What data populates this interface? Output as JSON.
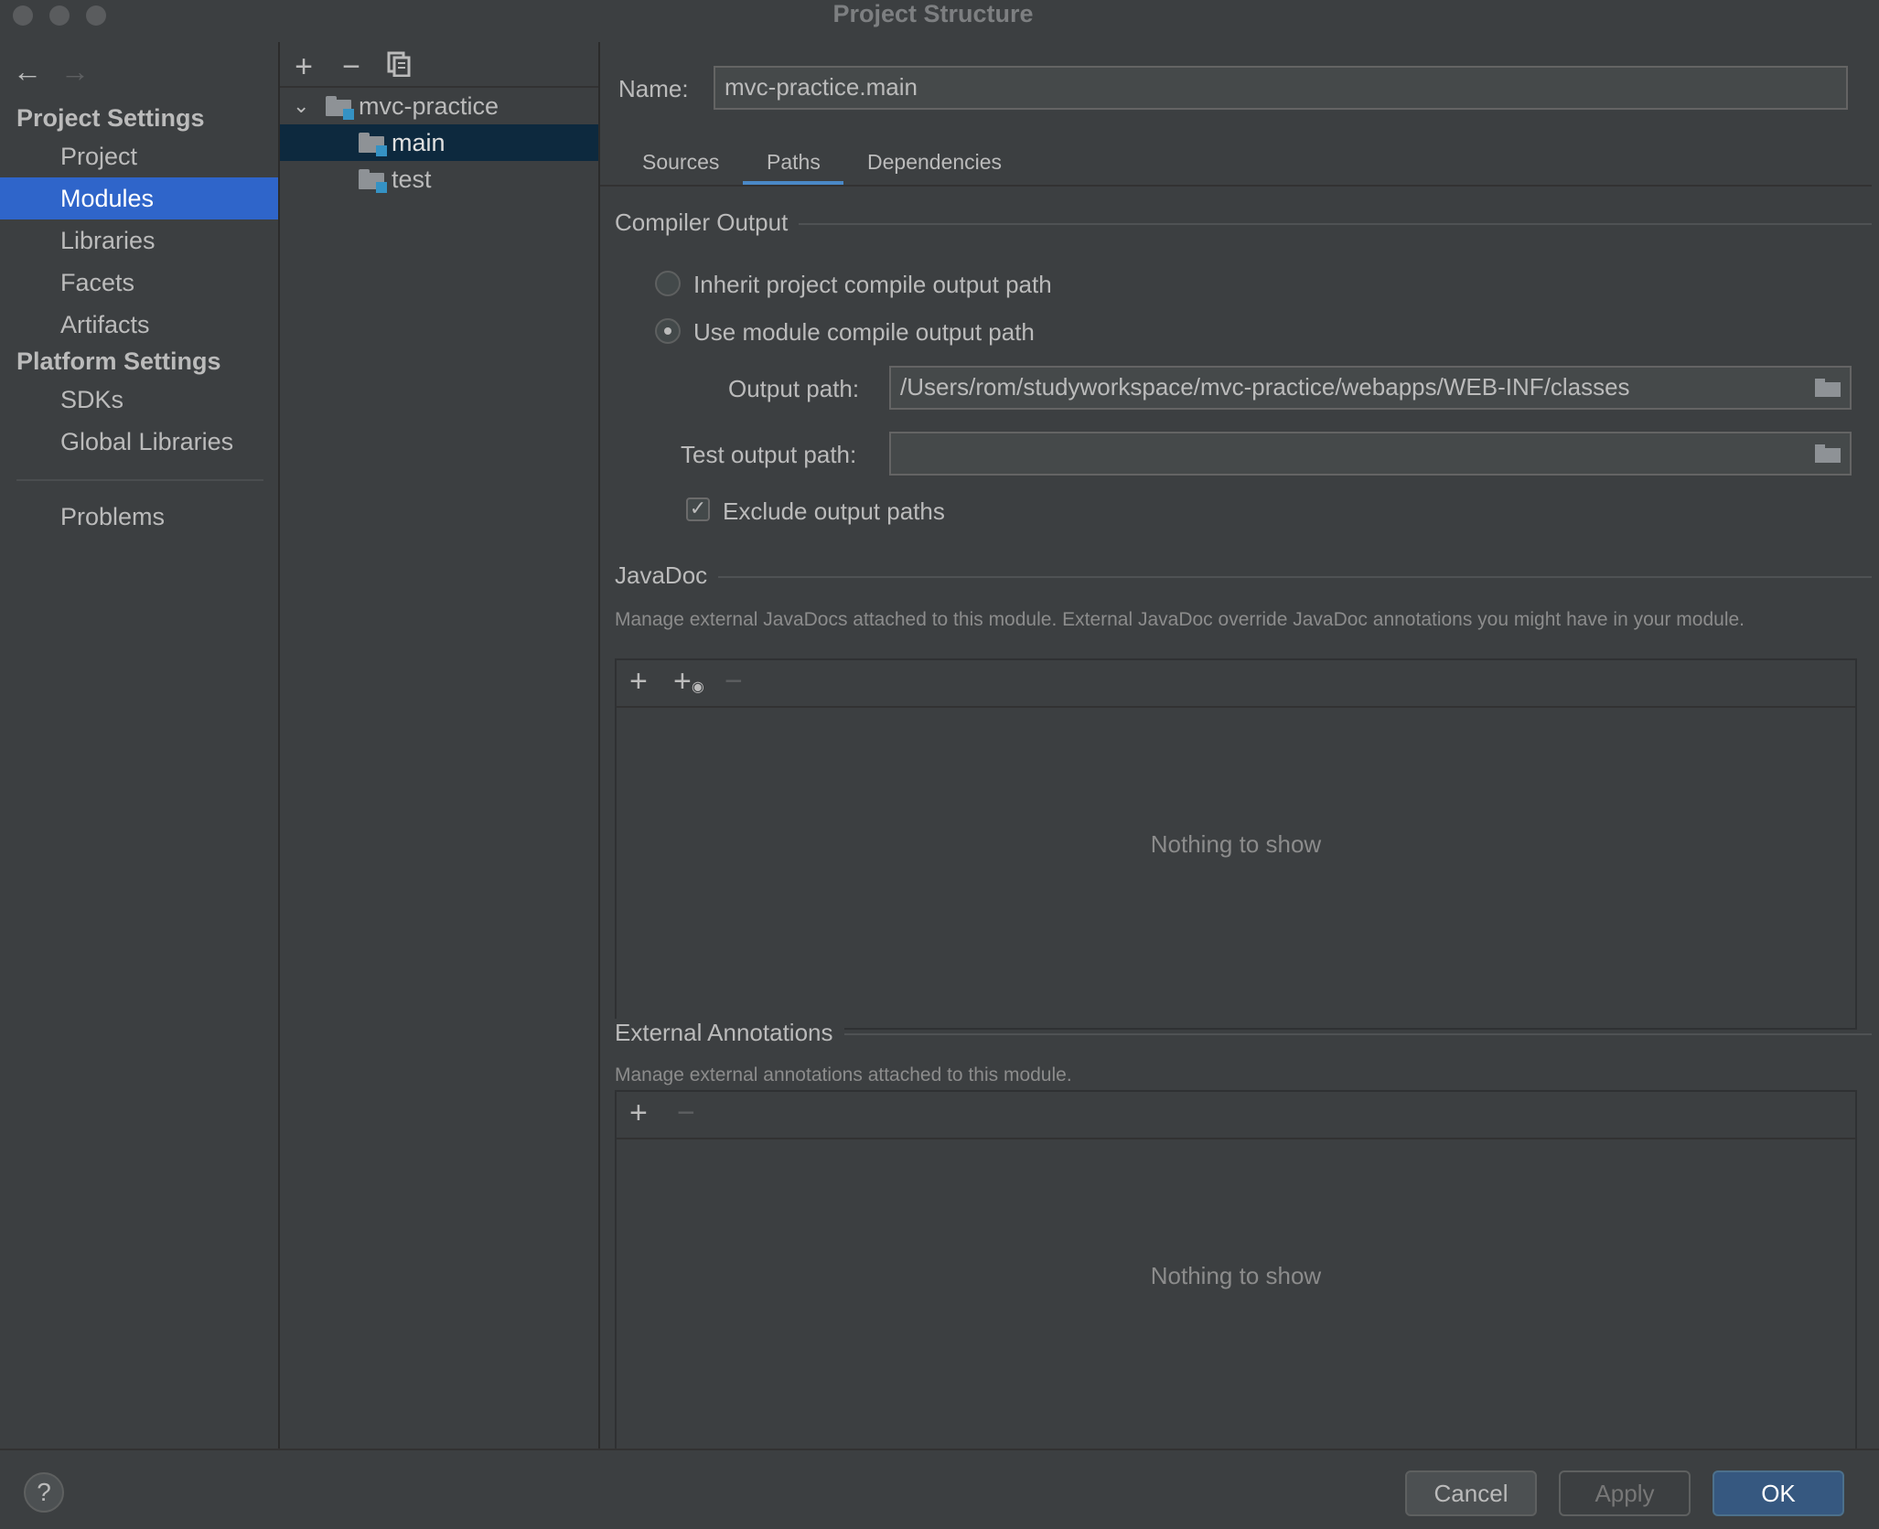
{
  "window": {
    "title": "Project Structure"
  },
  "nav": {
    "back_icon": "back-arrow-icon",
    "forward_icon": "forward-arrow-icon",
    "project_settings_header": "Project Settings",
    "platform_settings_header": "Platform Settings",
    "items": [
      {
        "label": "Project"
      },
      {
        "label": "Modules",
        "selected": true
      },
      {
        "label": "Libraries"
      },
      {
        "label": "Facets"
      },
      {
        "label": "Artifacts"
      }
    ],
    "platform_items": [
      {
        "label": "SDKs"
      },
      {
        "label": "Global Libraries"
      }
    ],
    "problems_label": "Problems"
  },
  "tree": {
    "toolbar": {
      "add": "+",
      "remove": "−",
      "copy_icon": "copy-icon"
    },
    "root": {
      "label": "mvc-practice",
      "expanded": true
    },
    "children": [
      {
        "label": "main",
        "selected": true
      },
      {
        "label": "test"
      }
    ]
  },
  "module": {
    "name_label": "Name:",
    "name_value": "mvc-practice.main",
    "tabs": [
      {
        "label": "Sources"
      },
      {
        "label": "Paths",
        "active": true
      },
      {
        "label": "Dependencies"
      }
    ],
    "compiler_output": {
      "title": "Compiler Output",
      "inherit_label": "Inherit project compile output path",
      "use_module_label": "Use module compile output path",
      "selected_option": "Use module compile output path",
      "output_path_label": "Output path:",
      "output_path_value": "/Users/rom/studyworkspace/mvc-practice/webapps/WEB-INF/classes",
      "test_output_path_label": "Test output path:",
      "test_output_path_value": "",
      "exclude_label": "Exclude output paths",
      "exclude_checked": true
    },
    "javadoc": {
      "title": "JavaDoc",
      "description": "Manage external JavaDocs attached to this module. External JavaDoc override JavaDoc annotations you might have in your module.",
      "empty_text": "Nothing to show"
    },
    "external_annotations": {
      "title": "External Annotations",
      "description": "Manage external annotations attached to this module.",
      "empty_text": "Nothing to show"
    }
  },
  "footer": {
    "help": "?",
    "cancel": "Cancel",
    "apply": "Apply",
    "ok": "OK"
  },
  "colors": {
    "background": "#3c3f41",
    "selection": "#2f65ca",
    "tree_selection": "#0d293e",
    "accent": "#4a88c7",
    "ok_button": "#365880"
  }
}
